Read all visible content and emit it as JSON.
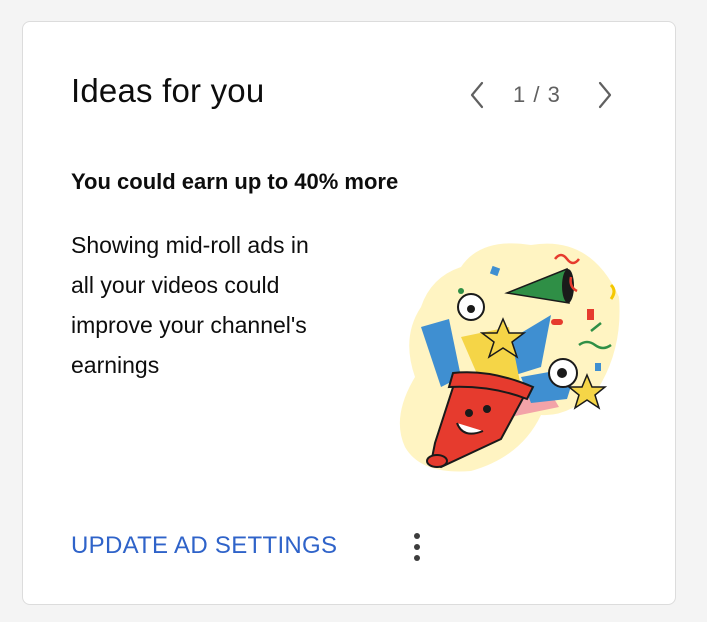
{
  "card": {
    "title": "Ideas for you",
    "pager": {
      "text": "1 / 3"
    },
    "headline": "You could earn up to 40% more",
    "body_lines": [
      "Showing mid-roll ads in",
      "all your videos could",
      "improve your channel's",
      "earnings"
    ],
    "action_label": "UPDATE AD SETTINGS",
    "more_icon": "more-vertical-icon",
    "illustration": "party-popper-illustration"
  },
  "colors": {
    "background": "#f4f4f4",
    "card": "#ffffff",
    "border": "#dcdcdc",
    "text": "#0d0d0d",
    "muted": "#606060",
    "link": "#2f63c9",
    "popper_red": "#e63b2e",
    "ribbon_blue": "#3f8fd1",
    "star_yellow": "#f5d547",
    "ribbon_pink": "#f3a3a8",
    "hat_green": "#2f8f46",
    "glow": "#fff4c2"
  }
}
